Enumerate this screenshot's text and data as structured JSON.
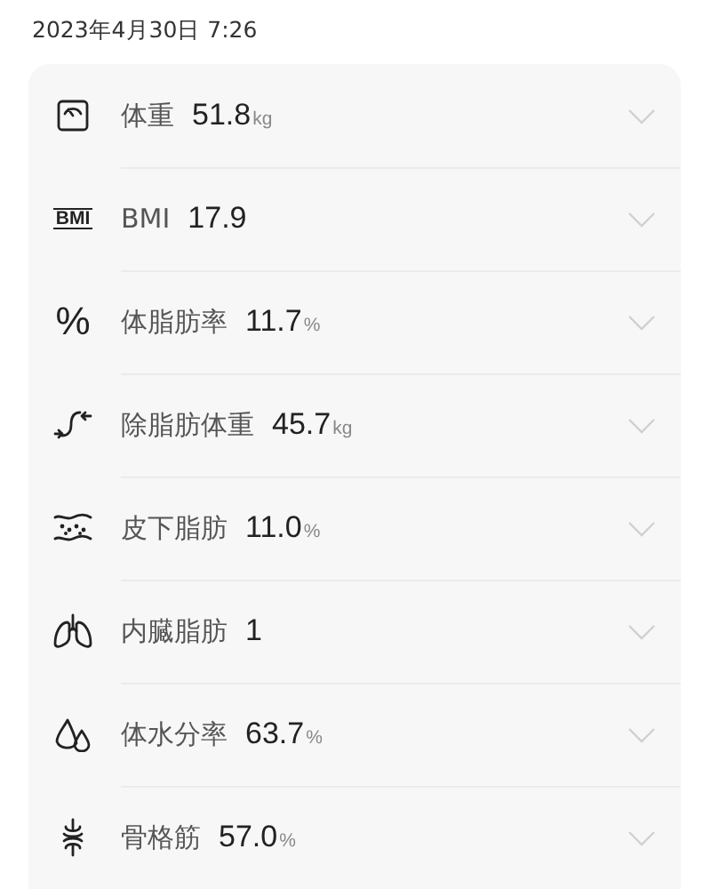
{
  "timestamp": "2023年4月30日 7:26",
  "metrics": [
    {
      "kind": "weight",
      "label": "体重",
      "value": "51.8",
      "unit": "kg",
      "expanded": false
    },
    {
      "kind": "glyph",
      "icon_text": "BMI",
      "label": "BMI",
      "value": "17.9",
      "expanded": false
    },
    {
      "kind": "glyph",
      "icon_text": "%",
      "label": "体脂肪率",
      "value": "11.7",
      "unit": "%",
      "expanded": false
    },
    {
      "kind": "lean",
      "label": "除脂肪体重",
      "value": "45.7",
      "unit": "kg",
      "expanded": false
    },
    {
      "kind": "subcutaneous",
      "label": "皮下脂肪",
      "value": "11.0",
      "unit": "%",
      "expanded": false
    },
    {
      "kind": "visceral",
      "label": "内臓脂肪",
      "value": "1",
      "expanded": false
    },
    {
      "kind": "water",
      "label": "体水分率",
      "value": "63.7",
      "unit": "%",
      "expanded": false
    },
    {
      "kind": "muscle",
      "label": "骨格筋",
      "value": "57.0",
      "unit": "%",
      "expanded": false
    }
  ]
}
